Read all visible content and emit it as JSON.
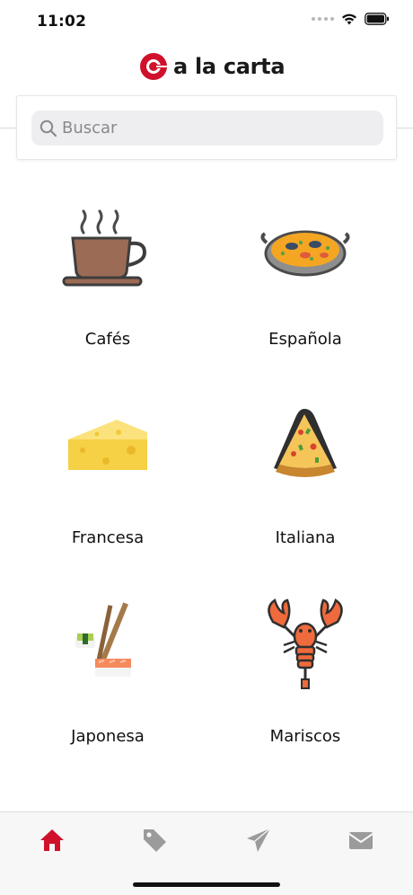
{
  "status_bar": {
    "time": "11:02"
  },
  "header": {
    "logo_text": "a la carta"
  },
  "search": {
    "placeholder": "Buscar",
    "value": ""
  },
  "categories": [
    {
      "label": "Cafés",
      "icon": "coffee-cup-icon"
    },
    {
      "label": "Española",
      "icon": "paella-pan-icon"
    },
    {
      "label": "Francesa",
      "icon": "cheese-wedge-icon"
    },
    {
      "label": "Italiana",
      "icon": "pizza-slice-icon"
    },
    {
      "label": "Japonesa",
      "icon": "sushi-chopsticks-icon"
    },
    {
      "label": "Mariscos",
      "icon": "lobster-icon"
    }
  ],
  "tabbar": {
    "items": [
      {
        "name": "home",
        "icon": "home-icon",
        "active": true
      },
      {
        "name": "offers",
        "icon": "tag-icon",
        "active": false
      },
      {
        "name": "send",
        "icon": "paper-plane-icon",
        "active": false
      },
      {
        "name": "messages",
        "icon": "envelope-icon",
        "active": false
      }
    ]
  },
  "colors": {
    "brand": "#d0112b",
    "tab_inactive": "#9b9b9b",
    "text": "#111111"
  }
}
